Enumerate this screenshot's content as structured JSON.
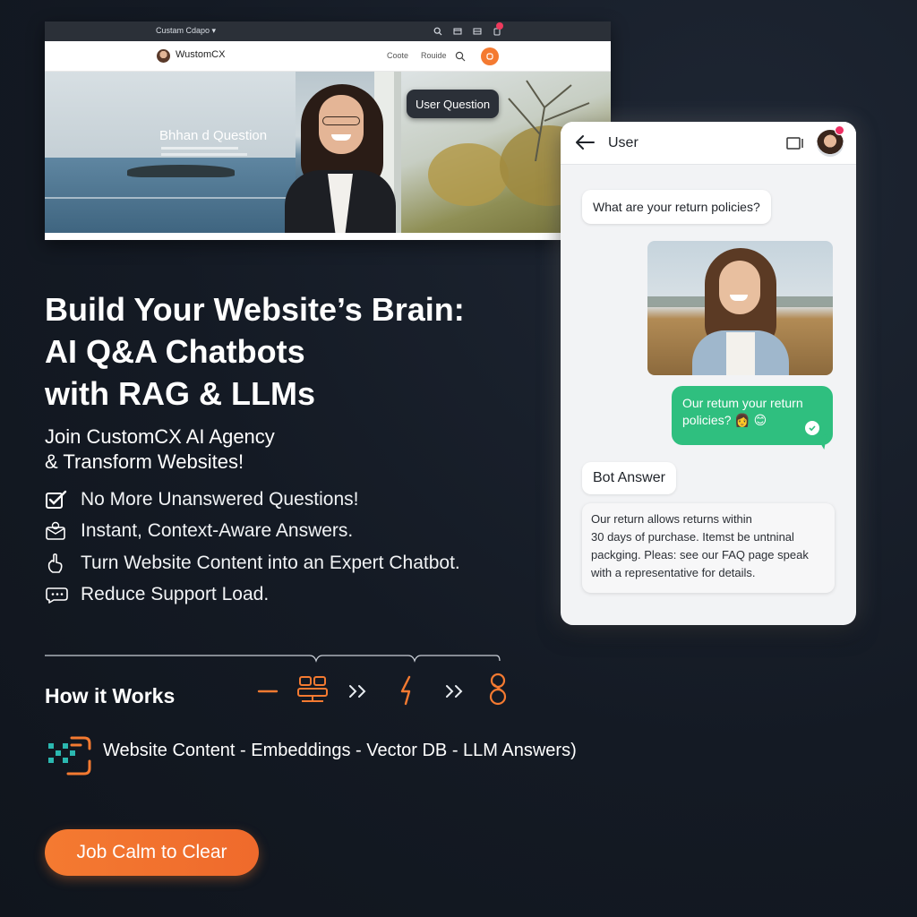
{
  "colors": {
    "background": "#141a24",
    "accent_orange": "#f47a31",
    "chat_green": "#2fbf7f",
    "notification_red": "#ef2f63",
    "pipeline_teal": "#2bb8b0"
  },
  "browser": {
    "tab_title": "Custam Cdapo ▾",
    "site_name": "WustomCX",
    "nav_links": [
      "Coote",
      "Rouide"
    ],
    "hero_heading": "Bhhan d Question",
    "user_question_tag": "User Question"
  },
  "chat": {
    "header_title": "User",
    "user_question": "What are your return policies?",
    "user_reply_line1": "Our retum your return",
    "user_reply_line2": "policies? 👩 😊",
    "bot_label": "Bot Answer",
    "bot_answer_lines": [
      "Our return allows returns within",
      "30 days of purchase. Itemst be untninal",
      "packging. Pleas: see our FAQ page speak",
      "with a representative for details."
    ]
  },
  "hero": {
    "headline_line1": "Build Your Website’s Brain:",
    "headline_line2": "AI Q&A Chatbots",
    "headline_line3": "with RAG & LLMs",
    "sub_line1": "Join CustomCX AI Agency",
    "sub_line2": "& Transform Websites!"
  },
  "features": [
    {
      "icon": "checkbox-icon",
      "text": "No More Unanswered Questions!"
    },
    {
      "icon": "message-box-icon",
      "text": "Instant, Context-Aware Answers."
    },
    {
      "icon": "hand-pointer-icon",
      "text": "Turn Website Content into an Expert Chatbot."
    },
    {
      "icon": "chat-bubble-icon",
      "text": "Reduce Support Load."
    }
  ],
  "how_it_works": {
    "title": "How it Works",
    "pipeline": "Website Content - Embeddings - Vector DB - LLM Answers)"
  },
  "cta": {
    "label": "Job Calm to Clear"
  }
}
